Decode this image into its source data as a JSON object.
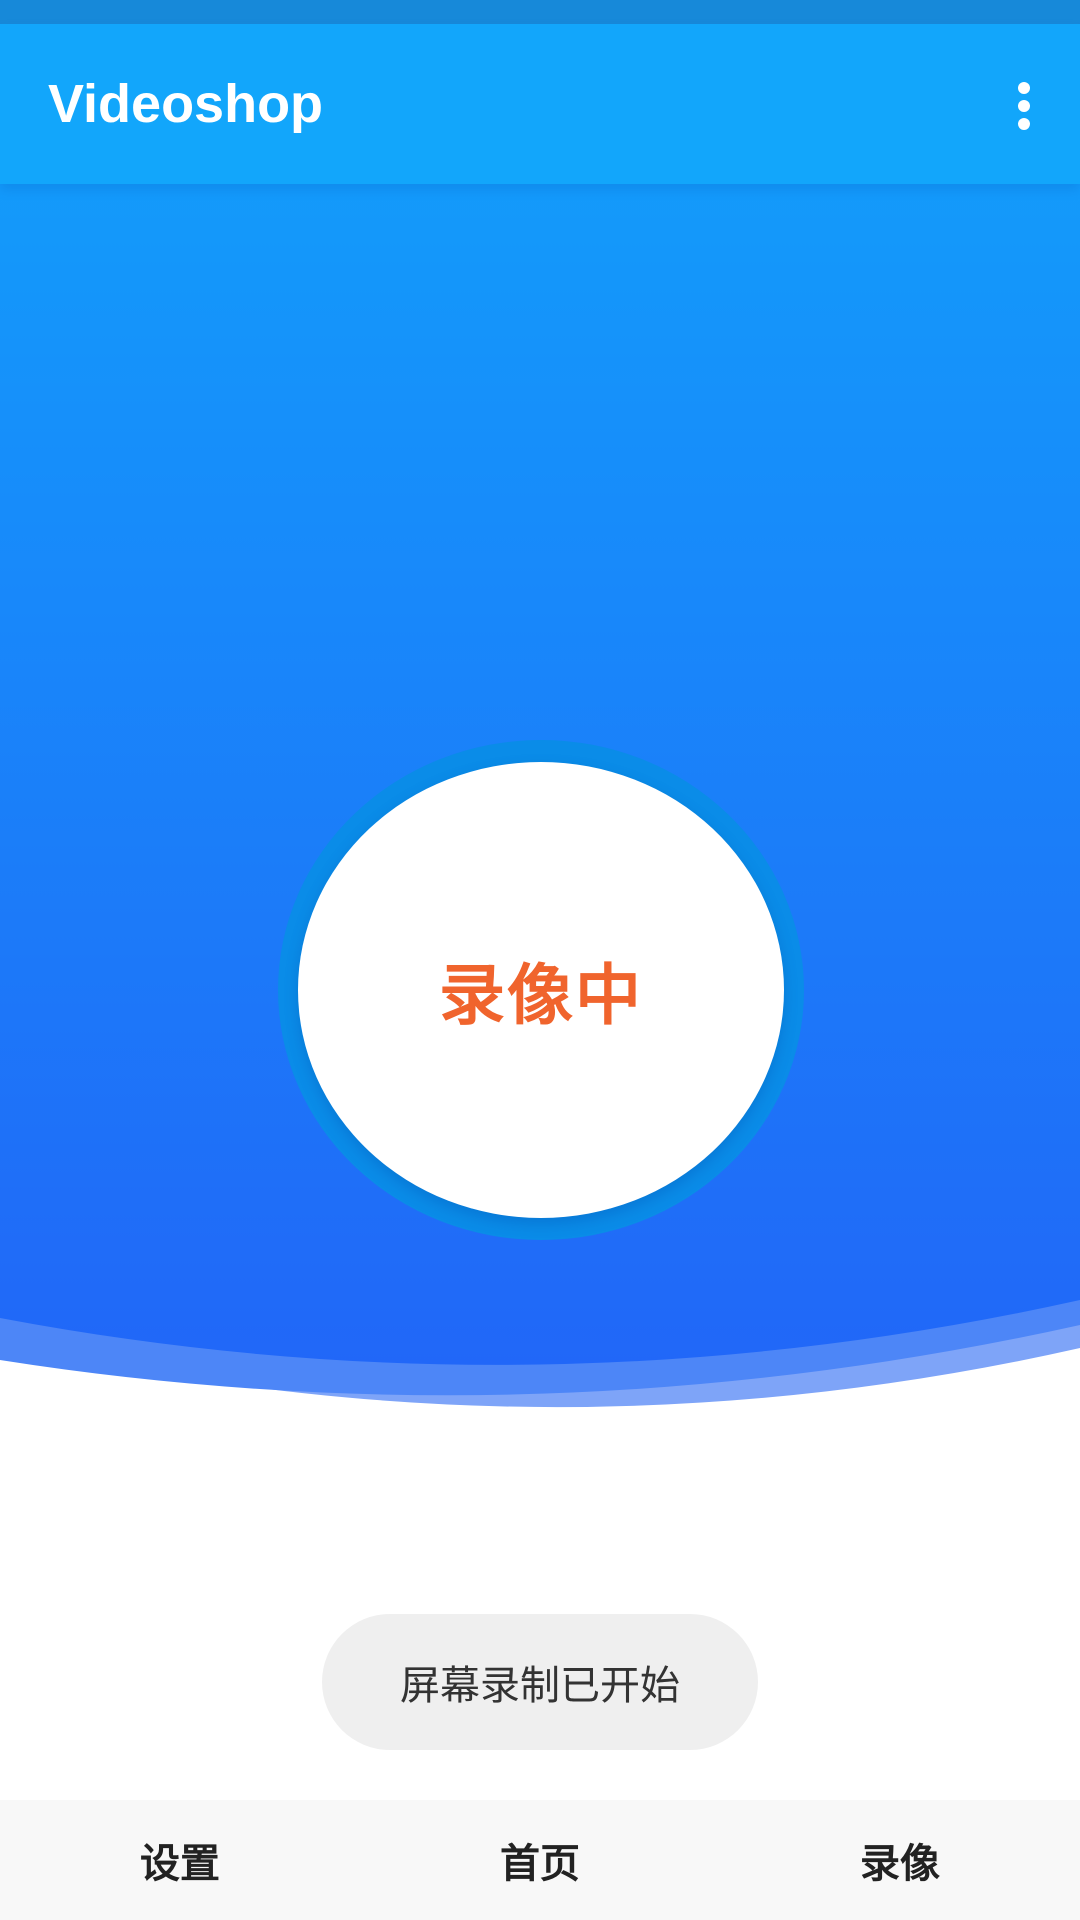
{
  "app": {
    "title": "Videoshop"
  },
  "icons": {
    "more": "more-vertical-icon"
  },
  "record": {
    "label": "录像中"
  },
  "toast": {
    "text": "屏幕录制已开始"
  },
  "bottom_nav": {
    "items": [
      {
        "label": "设置"
      },
      {
        "label": "首页"
      },
      {
        "label": "录像"
      }
    ]
  },
  "colors": {
    "app_bar": "#12a6fb",
    "gradient_top": "#11a2fb",
    "gradient_bottom": "#2167f8",
    "record_text": "#f0642d",
    "ring": "#0a8ce8",
    "toast_bg": "#efefef",
    "nav_bg": "#f8f8f8"
  }
}
